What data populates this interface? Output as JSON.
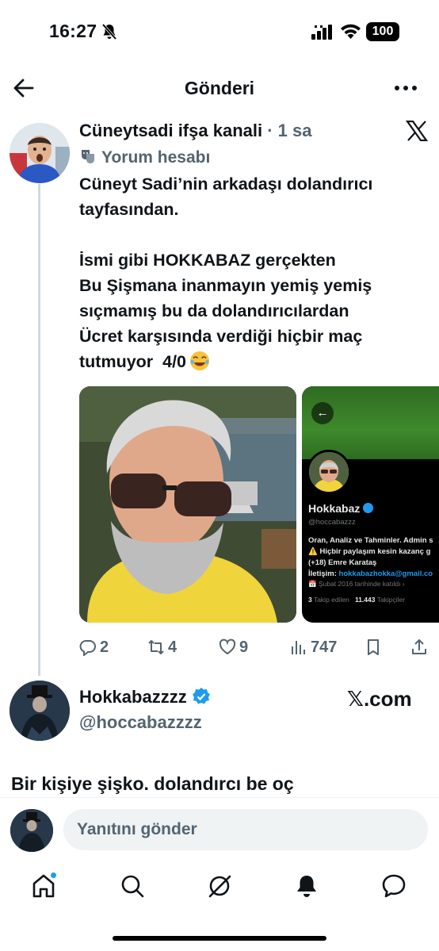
{
  "status": {
    "time": "16:27",
    "battery": "100"
  },
  "header": {
    "title": "Gönderi"
  },
  "tweet": {
    "author": "Cüneytsadi ifşa kanali",
    "time": "· 1 sa",
    "tag": "Yorum hesabı",
    "text": "Cüneyt Sadi’nin arkadaşı dolandırıcı tayfasından.\n\nİsmi gibi HOKKABAZ gerçekten\nBu Şişmana inanmayın yemiş yemiş sıçmamış bu da dolandırıcılardan\nÜcret karşısında verdiği hiçbir maç tutmuyor  4/0",
    "emoji_icon": "face-with-tears-of-joy-icon"
  },
  "screenshot_profile": {
    "name": "Hokkabaz",
    "handle": "@hoccabazzz",
    "bio": "Oran, Analiz ve Tahminler. Admin s\n⚠️ Hiçbir paylaşım kesin kazanç g\n(+18) Emre Karataş",
    "contact_label": "İletişim:",
    "contact_value": "hokkabazhokka@gmail.co",
    "joined": "Şubat 2016 tarihinde katıldı",
    "following_count": "3",
    "following_label": "Takip edilen",
    "followers_count": "11.443",
    "followers_label": "Takipçiler"
  },
  "actions": {
    "replies": "2",
    "retweets": "4",
    "likes": "9",
    "views": "747"
  },
  "quoted": {
    "name": "Hokkabazzzz",
    "handle": "@hoccabazzzz",
    "domain": "𝕏.com",
    "text": "Bir kişiye şişko. dolandırcı be oç"
  },
  "reply": {
    "placeholder": "Yanıtını gönder"
  },
  "colors": {
    "accent": "#1d9bf0",
    "text": "#0f1419",
    "muted": "#536471"
  }
}
